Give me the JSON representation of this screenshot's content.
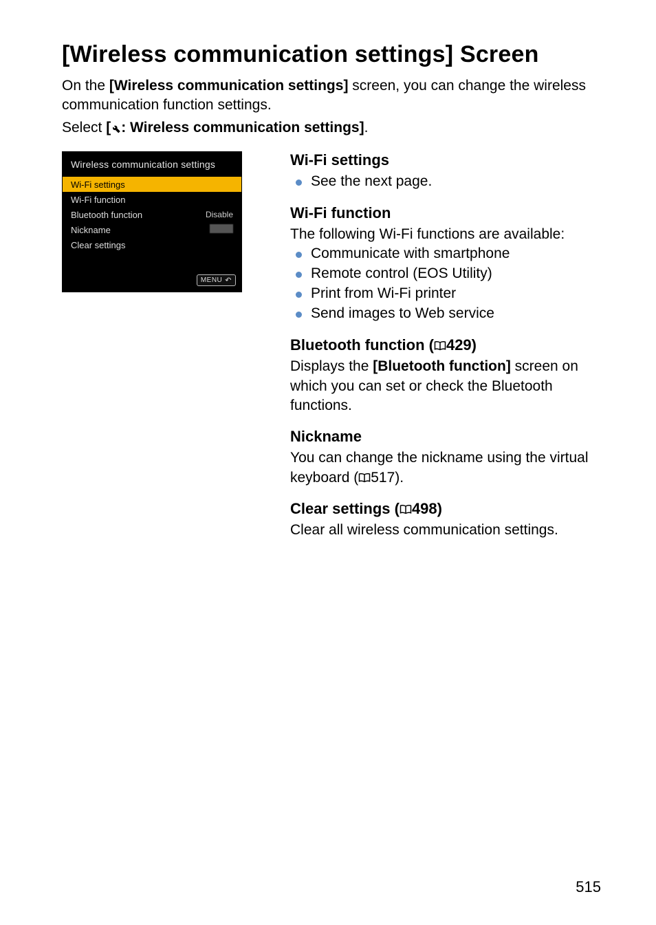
{
  "title": "[Wireless communication settings] Screen",
  "intro_pre": "On the ",
  "intro_bold": "[Wireless communication settings]",
  "intro_post": " screen, you can change the wireless communication function settings.",
  "select_pre": "Select ",
  "select_bold_open": "[",
  "select_bold_text": ": Wireless communication settings]",
  "select_post": ".",
  "lcd": {
    "header": "Wireless communication settings",
    "rows": [
      {
        "label": "Wi-Fi settings",
        "value": "",
        "selected": true
      },
      {
        "label": "Wi-Fi function",
        "value": "",
        "selected": false
      },
      {
        "label": "Bluetooth function",
        "value": "Disable",
        "selected": false
      },
      {
        "label": "Nickname",
        "value": "",
        "selected": false,
        "blurred": true
      },
      {
        "label": "Clear settings",
        "value": "",
        "selected": false
      }
    ],
    "menu_label": "MENU"
  },
  "sections": {
    "wifi_settings": {
      "heading": "Wi-Fi settings",
      "bullets": [
        "See the next page."
      ]
    },
    "wifi_function": {
      "heading": "Wi-Fi function",
      "intro": "The following Wi-Fi functions are available:",
      "bullets": [
        "Communicate with smartphone",
        "Remote control (EOS Utility)",
        "Print from Wi-Fi printer",
        "Send images to Web service"
      ]
    },
    "bluetooth": {
      "heading_pre": "Bluetooth function (",
      "heading_page": "429",
      "heading_post": ")",
      "line1_pre": "Displays the ",
      "line1_bold": "[Bluetooth function]",
      "line2": "screen on which you can set or check the Bluetooth functions."
    },
    "nickname": {
      "heading": "Nickname",
      "text_pre": "You can change the nickname using the virtual keyboard (",
      "text_page": "517",
      "text_post": ")."
    },
    "clear": {
      "heading_pre": "Clear settings (",
      "heading_page": "498",
      "heading_post": ")",
      "text": "Clear all wireless communication settings."
    }
  },
  "page_number": "515"
}
